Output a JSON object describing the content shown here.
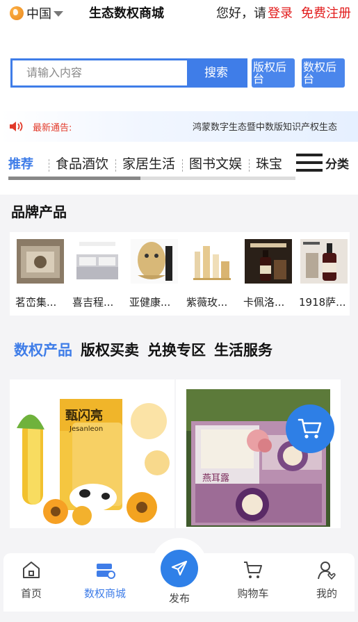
{
  "header": {
    "region": "中国",
    "app_title": "生态数权商城",
    "greeting": "您好，请",
    "login": "登录",
    "register": "免费注册"
  },
  "search": {
    "placeholder": "请输入内容",
    "button": "搜索",
    "copyright_admin": "版权后台",
    "digital_admin": "数权后台"
  },
  "notice": {
    "label": "最新通告:",
    "text": "鸿蒙数字生态暨中数版知识产权生态"
  },
  "categories": {
    "tabs": [
      "推荐",
      "食品酒饮",
      "家居生活",
      "图书文娱",
      "珠宝"
    ],
    "menu_label": "分类",
    "scroll_fraction": 0.46
  },
  "brands": {
    "title": "品牌产品",
    "items": [
      {
        "name": "茗峦集...",
        "icon": "bag-product"
      },
      {
        "name": "喜吉程...",
        "icon": "bedding-product"
      },
      {
        "name": "亚健康...",
        "icon": "beauty-mask-device"
      },
      {
        "name": "紫薇玫...",
        "icon": "cosmetics-set"
      },
      {
        "name": "卡佩洛...",
        "icon": "wine-bottle"
      },
      {
        "name": "1918萨...",
        "icon": "wine-bottle"
      }
    ]
  },
  "products": {
    "tabs": [
      "数权产品",
      "版权买卖",
      "兑换专区",
      "生活服务"
    ],
    "cards": [
      {
        "image": "milk-corn-product",
        "brand_text": "甄闪亮",
        "sub_text": "Jesanleon"
      },
      {
        "image": "birds-nest-gift-box",
        "brand_text": "燕耳露",
        "sub_text": ""
      }
    ]
  },
  "cart_fab": {
    "icon": "cart-icon"
  },
  "bottom_nav": {
    "items": [
      {
        "label": "首页",
        "icon": "home-icon"
      },
      {
        "label": "数权商城",
        "icon": "store-icon"
      },
      {
        "label": "发布",
        "icon": "send-icon"
      },
      {
        "label": "购物车",
        "icon": "cart-icon"
      },
      {
        "label": "我的",
        "icon": "user-icon"
      }
    ]
  },
  "colors": {
    "accent": "#3f7de8",
    "link_red": "#e21b1b"
  }
}
